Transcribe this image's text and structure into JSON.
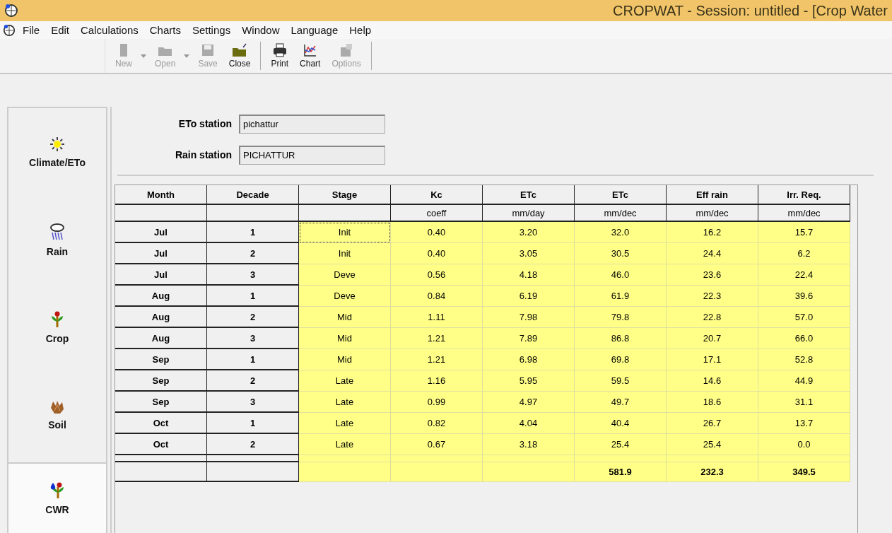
{
  "window": {
    "title": "CROPWAT - Session: untitled - [Crop Water"
  },
  "menu": [
    "File",
    "Edit",
    "Calculations",
    "Charts",
    "Settings",
    "Window",
    "Language",
    "Help"
  ],
  "toolbar": {
    "groups": [
      [
        {
          "label": "New",
          "disabled": true,
          "dropdown": true
        },
        {
          "label": "Open",
          "disabled": true,
          "dropdown": true
        },
        {
          "label": "Save",
          "disabled": true,
          "dropdown": false
        },
        {
          "label": "Close",
          "disabled": false,
          "dropdown": false
        }
      ],
      [
        {
          "label": "Print",
          "disabled": false,
          "dropdown": false
        },
        {
          "label": "Chart",
          "disabled": false,
          "dropdown": false
        },
        {
          "label": "Options",
          "disabled": true,
          "dropdown": false
        }
      ]
    ]
  },
  "sidebar": {
    "items": [
      {
        "label": "Climate/ETo",
        "selected": false
      },
      {
        "label": "Rain",
        "selected": false
      },
      {
        "label": "Crop",
        "selected": false
      },
      {
        "label": "Soil",
        "selected": false
      },
      {
        "label": "CWR",
        "selected": true
      }
    ]
  },
  "stations": [
    {
      "label": "ETo station",
      "value": "pichattur"
    },
    {
      "label": "Rain station",
      "value": "PICHATTUR"
    }
  ],
  "table": {
    "columns": [
      {
        "name": "Month"
      },
      {
        "name": "Decade"
      },
      {
        "name": "Stage"
      },
      {
        "name": "Kc",
        "unit": "coeff"
      },
      {
        "name": "ETc",
        "unit": "mm/day"
      },
      {
        "name": "ETc",
        "unit": "mm/dec"
      },
      {
        "name": "Eff rain",
        "unit": "mm/dec"
      },
      {
        "name": "Irr. Req.",
        "unit": "mm/dec"
      }
    ],
    "rows": [
      {
        "selected": true,
        "cells": [
          "Jul",
          "1",
          "Init",
          "0.40",
          "3.20",
          "32.0",
          "16.2",
          "15.7"
        ]
      },
      {
        "selected": false,
        "cells": [
          "Jul",
          "2",
          "Init",
          "0.40",
          "3.05",
          "30.5",
          "24.4",
          "6.2"
        ]
      },
      {
        "selected": false,
        "cells": [
          "Jul",
          "3",
          "Deve",
          "0.56",
          "4.18",
          "46.0",
          "23.6",
          "22.4"
        ]
      },
      {
        "selected": false,
        "cells": [
          "Aug",
          "1",
          "Deve",
          "0.84",
          "6.19",
          "61.9",
          "22.3",
          "39.6"
        ]
      },
      {
        "selected": false,
        "cells": [
          "Aug",
          "2",
          "Mid",
          "1.11",
          "7.98",
          "79.8",
          "22.8",
          "57.0"
        ]
      },
      {
        "selected": false,
        "cells": [
          "Aug",
          "3",
          "Mid",
          "1.21",
          "7.89",
          "86.8",
          "20.7",
          "66.0"
        ]
      },
      {
        "selected": false,
        "cells": [
          "Sep",
          "1",
          "Mid",
          "1.21",
          "6.98",
          "69.8",
          "17.1",
          "52.8"
        ]
      },
      {
        "selected": false,
        "cells": [
          "Sep",
          "2",
          "Late",
          "1.16",
          "5.95",
          "59.5",
          "14.6",
          "44.9"
        ]
      },
      {
        "selected": false,
        "cells": [
          "Sep",
          "3",
          "Late",
          "0.99",
          "4.97",
          "49.7",
          "18.6",
          "31.1"
        ]
      },
      {
        "selected": false,
        "cells": [
          "Oct",
          "1",
          "Late",
          "0.82",
          "4.04",
          "40.4",
          "26.7",
          "13.7"
        ]
      },
      {
        "selected": false,
        "cells": [
          "Oct",
          "2",
          "Late",
          "0.67",
          "3.18",
          "25.4",
          "25.4",
          "0.0"
        ]
      }
    ],
    "totals": {
      "etc_dec": "581.9",
      "eff_rain": "232.3",
      "irr_req": "349.5"
    }
  }
}
